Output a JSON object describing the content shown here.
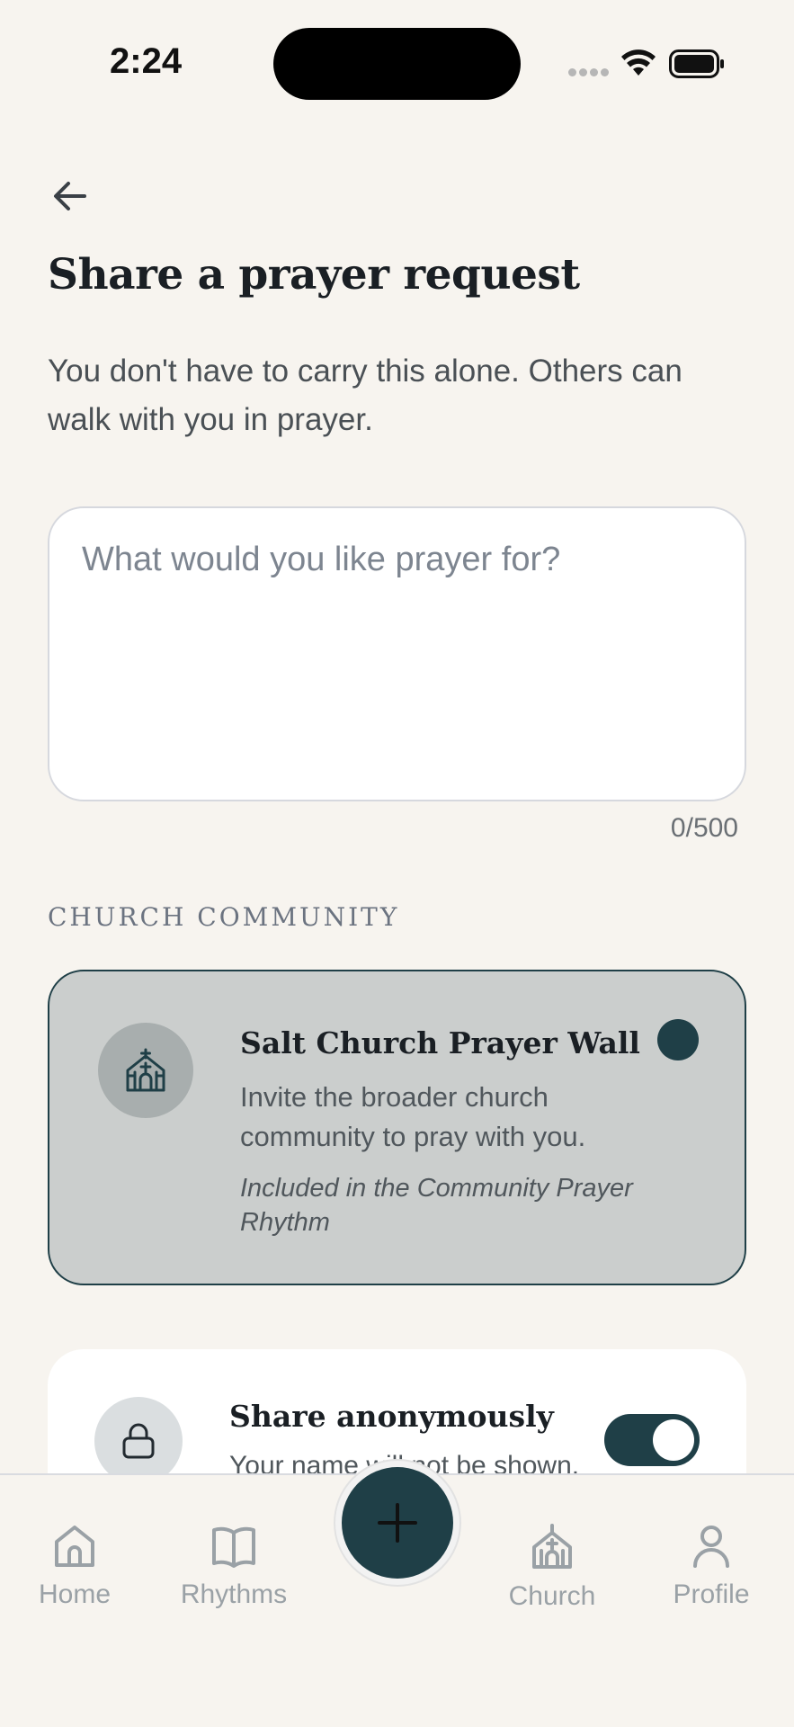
{
  "status_bar": {
    "time": "2:24"
  },
  "page": {
    "title": "Share a prayer request",
    "subtitle": "You don't have to carry this alone. Others can walk with you in prayer."
  },
  "prayer_input": {
    "placeholder": "What would you like prayer for?",
    "value": "",
    "counter": "0/500"
  },
  "section": {
    "heading": "CHURCH COMMUNITY"
  },
  "church_option": {
    "icon": "church-icon",
    "title": "Salt Church Prayer Wall",
    "description": "Invite the broader church community to pray with you.",
    "note": "Included in the Community Prayer Rhythm",
    "selected": true
  },
  "anonymous_option": {
    "icon": "lock-icon",
    "title": "Share anonymously",
    "description": "Your name will not be shown.",
    "enabled": true
  },
  "tab_bar": {
    "items": [
      {
        "label": "Home",
        "icon": "home-icon"
      },
      {
        "label": "Rhythms",
        "icon": "book-icon"
      },
      {
        "label": "Church",
        "icon": "church-icon"
      },
      {
        "label": "Profile",
        "icon": "person-icon"
      }
    ],
    "fab_icon": "plus-icon"
  },
  "colors": {
    "background": "#f7f4ef",
    "accent": "#1f3f47",
    "selected_card": "#cbcecd",
    "muted_text": "#9aa1a6"
  }
}
